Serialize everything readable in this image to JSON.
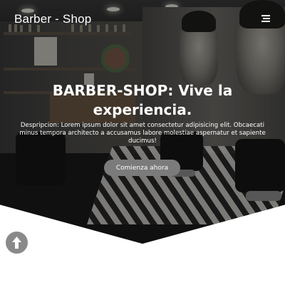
{
  "header": {
    "brand": "Barber - Shop",
    "menu_icon": "hamburger-menu-icon"
  },
  "hero": {
    "headline": "BARBER-SHOP: Vive la experiencia.",
    "description": "Despripcion: Lorem ipsum dolor sit amet consectetur adipisicing elit. Obcaecati minus tempora architecto a accusamus labore molestiae aspernatur et sapiente ducimus!",
    "cta_label": "Comienza ahora",
    "background": "barbershop-interior-photo"
  },
  "scroll_top": {
    "icon": "arrow-up-icon"
  },
  "colors": {
    "text": "#ffffff",
    "button": "#7b7b7b",
    "scroll_button": "#8a8a8a",
    "page_background": "#ffffff"
  }
}
